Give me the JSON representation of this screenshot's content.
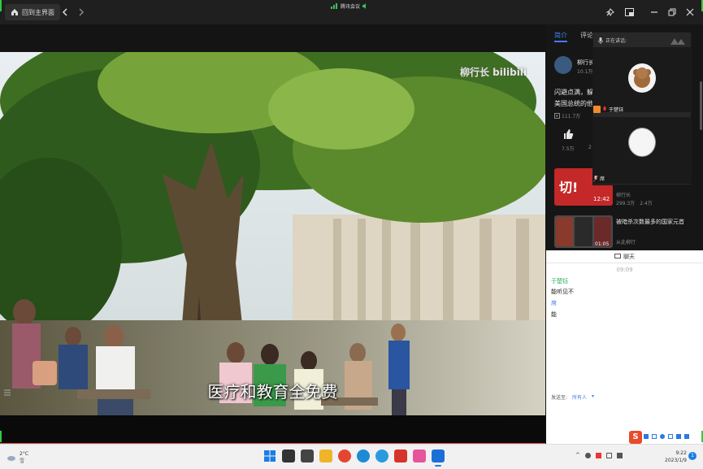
{
  "titlebar": {
    "home_label": "回到主界面",
    "meeting_label": "腾讯会议"
  },
  "video": {
    "subtitle": "医疗和教育全免费",
    "watermark": "柳行长 bilibili"
  },
  "panel": {
    "tabs": [
      "简介",
      "评论"
    ],
    "uploader_line": "柳行长",
    "uploader_sub": "10.1万",
    "desc_line1": "闪避点满，躲",
    "desc_line2": "美国总统的他",
    "views": "111.7万",
    "likes": "7.5万",
    "likes_partial": "2",
    "rec1_badge": "切!",
    "rec1_duration": "12:42",
    "rec1_author": "柳行长",
    "rec1_views": "299.3万",
    "rec1_comments": "2.4万",
    "rec2_title": "被暗杀次数最多的国家元首",
    "rec2_author": "从此柳行",
    "rec2_duration": "01:05"
  },
  "speaker": {
    "talking_label": "正在讲话:",
    "user1_name": "于楚钰",
    "user2_name": "席"
  },
  "chat": {
    "title": "聊天",
    "time": "09:09",
    "messages": [
      {
        "sender": "于楚钰",
        "text": "能听见不"
      },
      {
        "sender": "席",
        "text": "能"
      }
    ],
    "send_to_label": "发送至:",
    "send_to_value": "所有人"
  },
  "taskbar": {
    "weather_temp": "2°C",
    "weather_desc": "雪",
    "time": "9:22",
    "date": "2023/1/9"
  },
  "colors": {
    "accent": "#3f7ff0",
    "tab_active": "#3f7ff0",
    "chat_sender": "#2fae5a"
  }
}
